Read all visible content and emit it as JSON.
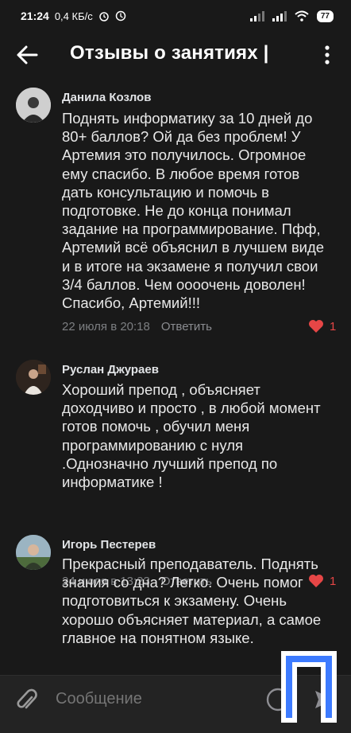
{
  "status_bar": {
    "time": "21:24",
    "speed": "0,4 КБ/с",
    "battery": "77"
  },
  "header": {
    "title": "Отзывы о занятиях | "
  },
  "comments": [
    {
      "author": "Данила Козлов",
      "text": "Поднять информатику за 10 дней до 80+ баллов? Ой да без проблем! У Артемия это получилось. Огромное ему спасибо. В любое время готов дать консультацию и помочь в подготовке. Не до конца понимал задание на программирование. Пфф, Артемий всё объяснил в лучшем виде и в итоге на экзамене я получил свои 3/4 баллов. Чем оооочень доволен! Спасибо, Артемий!!!",
      "date": "22 июля в 20:18",
      "reply": "Ответить",
      "likes": "1"
    },
    {
      "author": "Руслан Джураев",
      "text": "Хороший препод , объясняет доходчиво и просто , в любой момент готов помочь , обучил меня программированию с нуля .Однозначно лучший препод по информатике !",
      "date": "24 июля в 13:23",
      "reply": "Ответить",
      "likes": "1"
    },
    {
      "author": "Игорь Пестерев",
      "text": "Прекрасный преподаватель. Поднять знания со дна? Легко. Очень помог подготовиться к экзамену. Очень хорошо объясняет материал,  а самое главное на понятном языке."
    }
  ],
  "composer": {
    "placeholder": "Сообщение"
  },
  "icons": {
    "back": "arrow-left-icon",
    "more": "more-vertical-icon",
    "attach": "paperclip-icon",
    "emoji": "emoji-icon",
    "send": "send-icon",
    "heart": "heart-icon"
  },
  "colors": {
    "background": "#191919",
    "like": "#e64646",
    "muted": "#7d7f82",
    "logo": "#3d7bff"
  }
}
